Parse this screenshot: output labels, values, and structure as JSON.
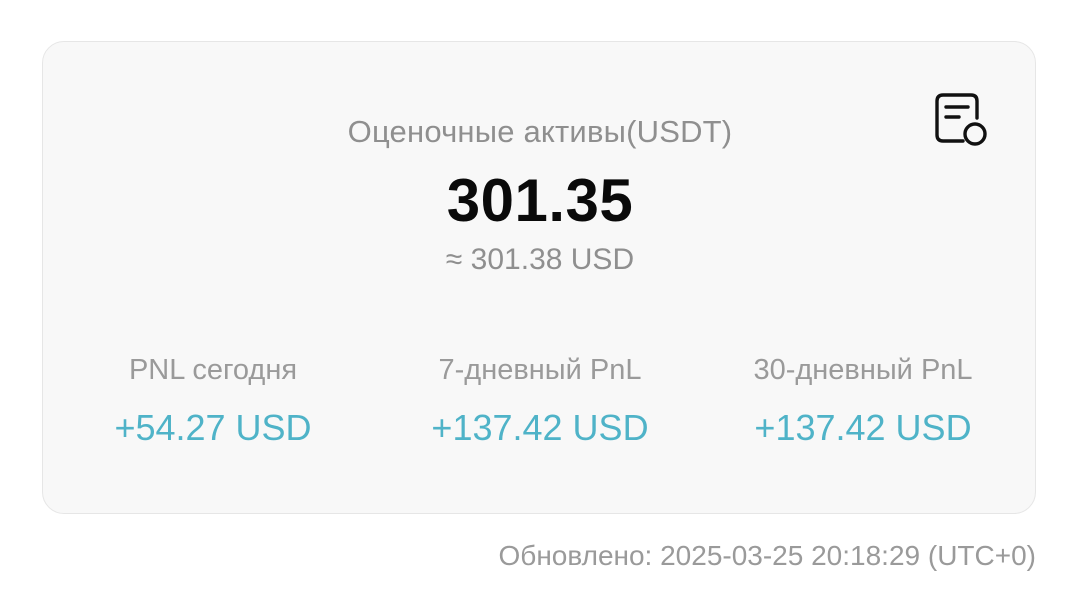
{
  "card": {
    "title": "Оценочные активы(USDT)",
    "value": "301.35",
    "approx": "≈ 301.38 USD",
    "history_icon": "document-history-icon"
  },
  "pnl": [
    {
      "label": "PNL сегодня",
      "value": "+54.27 USD"
    },
    {
      "label": "7-дневный PnL",
      "value": "+137.42 USD"
    },
    {
      "label": "30-дневный PnL",
      "value": "+137.42 USD"
    }
  ],
  "updated": "Обновлено: 2025-03-25 20:18:29 (UTC+0)",
  "colors": {
    "positive": "#4fb3c8",
    "muted": "#8f8f8f",
    "card_bg": "#f8f8f8"
  }
}
